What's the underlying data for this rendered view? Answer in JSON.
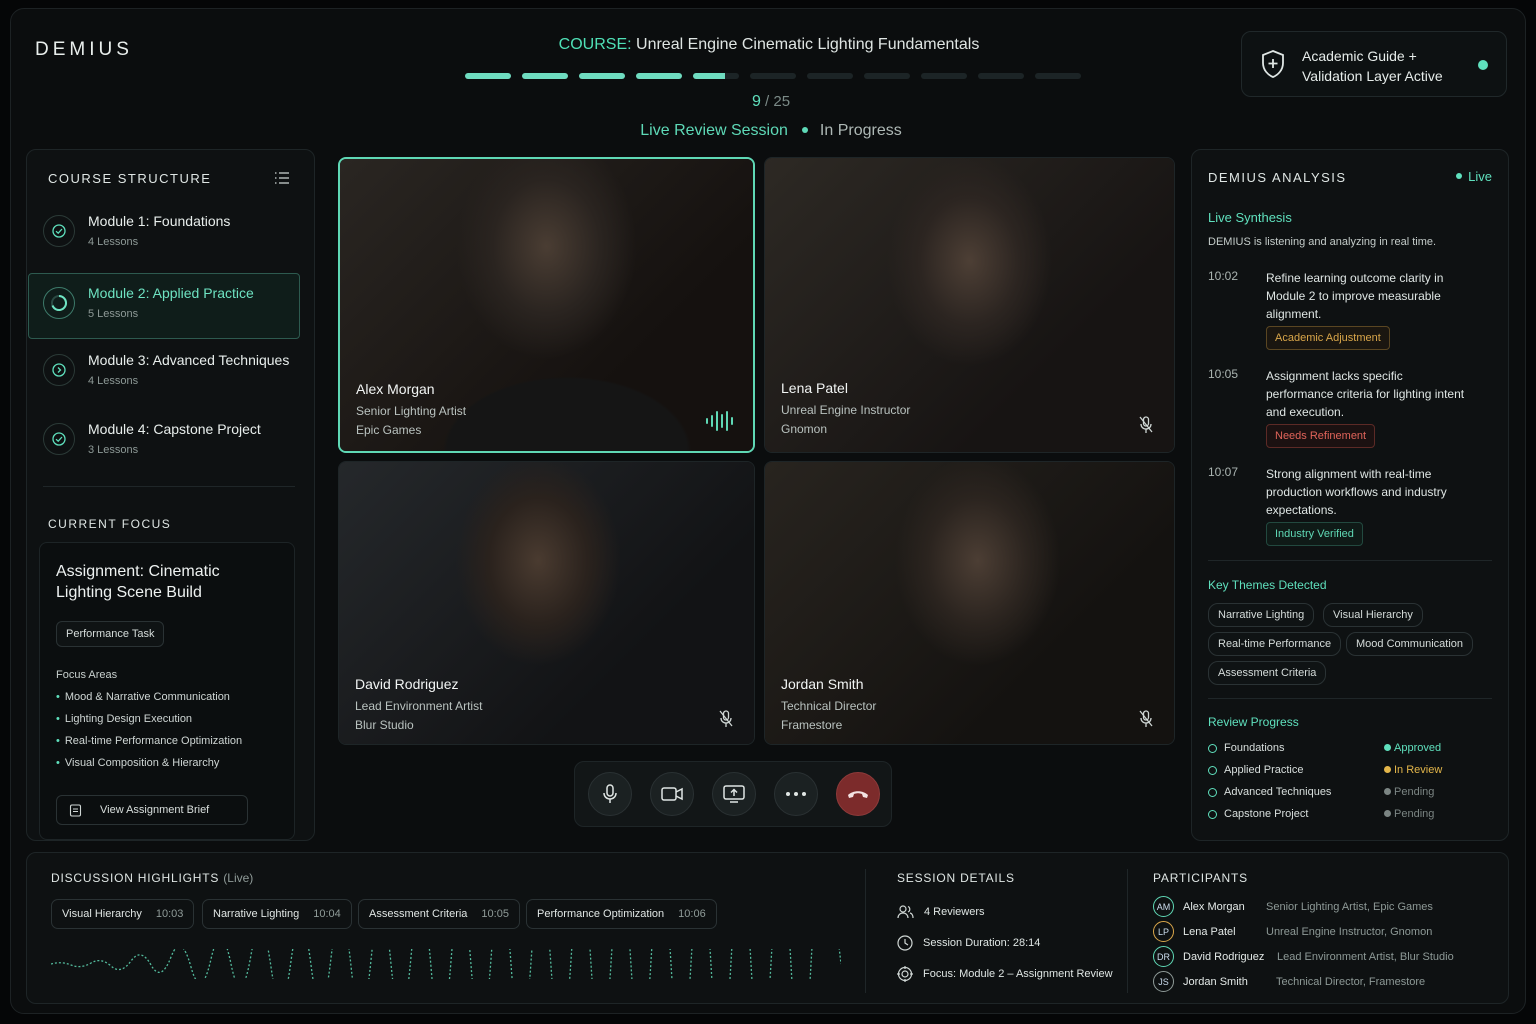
{
  "app": {
    "logo": "DEMIUS",
    "course_label": "COURSE:",
    "course_title": "Unreal Engine Cinematic Lighting Fundamentals",
    "step_current": "9",
    "step_total": "/ 25",
    "progress": 0.34,
    "session": "Live Review Session",
    "session_status": "In Progress"
  },
  "guide": {
    "line1": "Academic Guide +",
    "line2": "Validation Layer Active",
    "icon": "shield-plus-icon"
  },
  "structure": {
    "title": "COURSE STRUCTURE",
    "modules": [
      {
        "title": "Module 1: Foundations",
        "sub": "4 Lessons",
        "state": "complete"
      },
      {
        "title": "Module 2: Applied Practice",
        "sub": "5 Lessons",
        "state": "active"
      },
      {
        "title": "Module 3: Advanced Techniques",
        "sub": "4 Lessons",
        "state": "pending"
      },
      {
        "title": "Module 4: Capstone Project",
        "sub": "3 Lessons",
        "state": "complete"
      }
    ]
  },
  "focus": {
    "header": "CURRENT FOCUS",
    "title": "Assignment: Cinematic Lighting Scene Build",
    "tag": "Performance Task",
    "areas_label": "Focus Areas",
    "areas": [
      "Mood & Narrative Communication",
      "Lighting Design Execution",
      "Real-time Performance Optimization",
      "Visual Composition & Hierarchy"
    ],
    "button": "View Assignment Brief"
  },
  "participants_video": [
    {
      "name": "Alex Morgan",
      "role": "Senior Lighting Artist",
      "org": "Epic Games",
      "speaking": true
    },
    {
      "name": "Lena Patel",
      "role": "Unreal Engine Instructor",
      "org": "Gnomon",
      "speaking": false
    },
    {
      "name": "David Rodriguez",
      "role": "Lead Environment Artist",
      "org": "Blur Studio",
      "speaking": false
    },
    {
      "name": "Jordan Smith",
      "role": "Technical Director",
      "org": "Framestore",
      "speaking": false
    }
  ],
  "analysis": {
    "title": "DEMIUS ANALYSIS",
    "live": "Live",
    "synth_title": "Live Synthesis",
    "synth_sub": "DEMIUS is listening and analyzing in real time.",
    "entries": [
      {
        "time": "10:02",
        "text": "Refine learning outcome clarity in Module 2 to improve measurable alignment.",
        "tag": "Academic Adjustment",
        "color": "#d9a64a"
      },
      {
        "time": "10:05",
        "text": "Assignment lacks specific performance criteria for lighting intent and execution.",
        "tag": "Needs Refinement",
        "color": "#e0645a"
      },
      {
        "time": "10:07",
        "text": "Strong alignment with real-time production workflows and industry expectations.",
        "tag": "Industry Verified",
        "color": "#5fd8b5"
      }
    ],
    "themes_title": "Key Themes Detected",
    "themes": [
      "Narrative Lighting",
      "Visual Hierarchy",
      "Real-time Performance",
      "Mood Communication",
      "Assessment Criteria"
    ],
    "review_title": "Review Progress",
    "review": [
      {
        "name": "Foundations",
        "status": "Approved",
        "color": "#5fe0bd"
      },
      {
        "name": "Applied Practice",
        "status": "In Review",
        "color": "#e3b64a"
      },
      {
        "name": "Advanced Techniques",
        "status": "Pending",
        "color": "#7b8583"
      },
      {
        "name": "Capstone Project",
        "status": "Pending",
        "color": "#7b8583"
      }
    ]
  },
  "highlights": {
    "title": "DISCUSSION HIGHLIGHTS",
    "live": "(Live)",
    "items": [
      {
        "label": "Visual Hierarchy",
        "time": "10:03"
      },
      {
        "label": "Narrative Lighting",
        "time": "10:04"
      },
      {
        "label": "Assessment Criteria",
        "time": "10:05"
      },
      {
        "label": "Performance Optimization",
        "time": "10:06"
      }
    ]
  },
  "session": {
    "title": "SESSION DETAILS",
    "reviewers": "4 Reviewers",
    "duration": "Session Duration: 28:14",
    "focus": "Focus: Module 2 – Assignment Review"
  },
  "participants": {
    "title": "PARTICIPANTS",
    "list": [
      {
        "initials": "AM",
        "name": "Alex Morgan",
        "role": "Senior Lighting Artist, Epic Games"
      },
      {
        "initials": "LP",
        "name": "Lena Patel",
        "role": "Unreal Engine Instructor, Gnomon"
      },
      {
        "initials": "DR",
        "name": "David Rodriguez",
        "role": "Lead Environment Artist, Blur Studio"
      },
      {
        "initials": "JS",
        "name": "Jordan Smith",
        "role": "Technical Director, Framestore"
      }
    ]
  },
  "colors": {
    "accent": "#5fe0bd",
    "end_call": "#7c2b2b"
  }
}
